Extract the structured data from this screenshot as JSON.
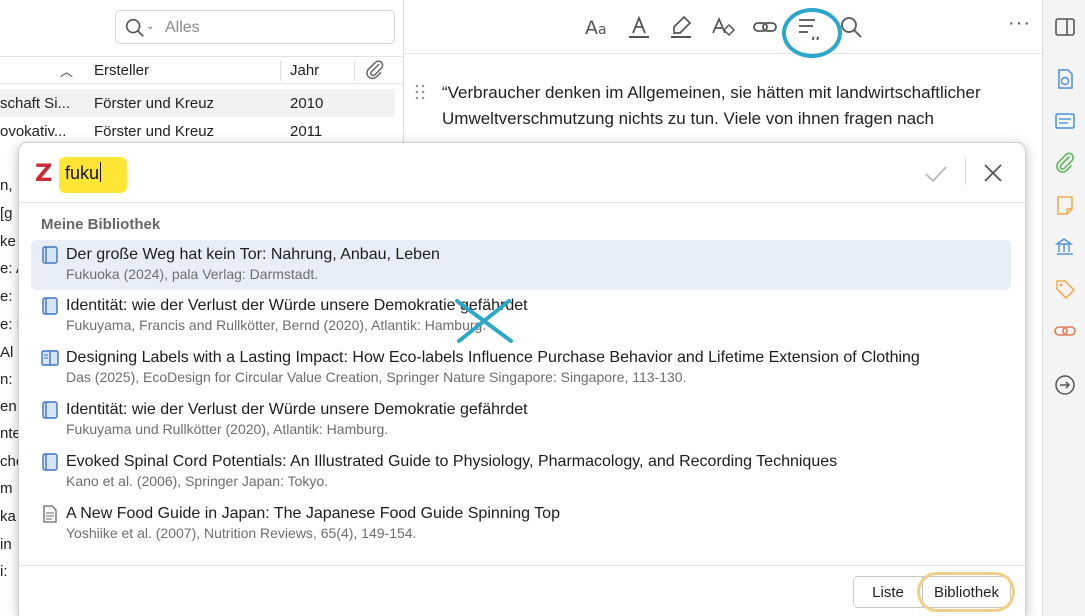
{
  "library": {
    "search_placeholder": "Alles",
    "columns": {
      "creator": "Ersteller",
      "year": "Jahr"
    },
    "rows": [
      {
        "title": "schaft Si...",
        "creator": "Förster und Kreuz",
        "year": "2010"
      },
      {
        "title": "ovokativ...",
        "creator": "Förster und Kreuz",
        "year": "2011"
      }
    ],
    "stubs": [
      "n,",
      "[g",
      "ke",
      "e: A",
      "e:",
      "e: N",
      "Al",
      "n:",
      "en",
      "nte",
      "cho",
      "m",
      "ka",
      "in",
      "i:"
    ]
  },
  "document": {
    "line1": "“Verbraucher denken im Allgemeinen, sie hätten mit landwirtschaftlicher",
    "line2": "Umweltverschmutzung nichts zu tun. Viele von ihnen fragen nach"
  },
  "dialog": {
    "logo": "Z",
    "query": "fuku",
    "group_label": "Meine Bibliothek",
    "items": [
      {
        "icon": "book-icon",
        "title": "Der große Weg hat kein Tor: Nahrung, Anbau, Leben",
        "sub": "Fukuoka (2024), pala Verlag: Darmstadt."
      },
      {
        "icon": "book-icon",
        "title": "Identität: wie der Verlust der Würde unsere Demokratie gefährdet",
        "sub": "Fukuyama, Francis and Rullkötter, Bernd (2020), Atlantik: Hamburg."
      },
      {
        "icon": "book-section-icon",
        "title": "Designing Labels with a Lasting Impact: How Eco-labels Influence Purchase Behavior and Lifetime Extension of Clothing",
        "sub": "Das (2025), EcoDesign for Circular Value Creation, Springer Nature Singapore: Singapore, 113-130."
      },
      {
        "icon": "book-icon",
        "title": "Identität: wie der Verlust der Würde unsere Demokratie gefährdet",
        "sub": "Fukuyama und Rullkötter (2020), Atlantik: Hamburg."
      },
      {
        "icon": "book-icon",
        "title": "Evoked Spinal Cord Potentials: An Illustrated Guide to Physiology, Pharmacology, and Recording Techniques",
        "sub": "Kano et al. (2006), Springer Japan: Tokyo."
      },
      {
        "icon": "journal-article-icon",
        "title": "A New Food Guide in Japan: The Japanese Food Guide Spinning Top",
        "sub": "Yoshiike et al. (2007), Nutrition Reviews, 65(4), 149-154."
      }
    ],
    "buttons": {
      "list": "Liste",
      "library": "Bibliothek"
    }
  },
  "colors": {
    "annotation_cyan": "#2aa7c9",
    "highlight_yellow": "#ffe534",
    "zotero_red": "#cc2936",
    "selection_blue": "#e8eef9",
    "button_highlight": "#f3ce88"
  }
}
